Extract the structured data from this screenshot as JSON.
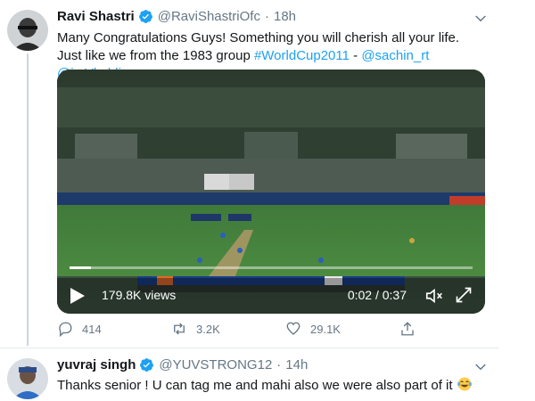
{
  "tweet1": {
    "name": "Ravi Shastri",
    "handle": "@RaviShastriOfc",
    "separator": "·",
    "time": "18h",
    "text_plain": "Many Congratulations Guys! Something you will cherish all your life. Just like we from the 1983 group ",
    "hashtag": "#WorldCup2011",
    "dash": " - ",
    "mention1": "@sachin_rt",
    "space": " ",
    "mention2": "@imVkohli",
    "video": {
      "views": "179.8K views",
      "time": "0:02 / 0:37",
      "progress_fraction": 0.054
    },
    "actions": {
      "replies": "414",
      "retweets": "3.2K",
      "likes": "29.1K"
    }
  },
  "tweet2": {
    "name": "yuvraj singh",
    "handle": "@YUVSTRONG12",
    "separator": "·",
    "time": "14h",
    "text": "Thanks senior ! U can tag me and mahi also we were also part of it",
    "emoji": "face-with-tears-of-joy"
  },
  "colors": {
    "link": "#1da1f2",
    "secondary_text": "#657786",
    "verified": "#1da1f2"
  }
}
